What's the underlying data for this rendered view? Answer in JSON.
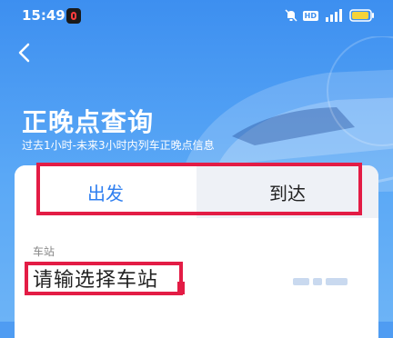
{
  "status_bar": {
    "time": "15:49",
    "icons": [
      "app-notification-icon",
      "mute-bell-icon",
      "hd-icon",
      "5g-signal-icon",
      "battery-icon"
    ],
    "hd_label": "HD"
  },
  "header": {
    "back_icon": "chevron-left-icon",
    "title": "正晚点查询",
    "subtitle": "过去1小时-未来3小时内列车正晚点信息"
  },
  "tabs": [
    {
      "label": "出发",
      "active": true
    },
    {
      "label": "到达",
      "active": false
    }
  ],
  "station_field": {
    "label": "车站",
    "value": "请输选择车站"
  },
  "colors": {
    "accent": "#2f7ff0",
    "highlight_box": "#e31c45",
    "header_bg": "#4f9cf2"
  }
}
